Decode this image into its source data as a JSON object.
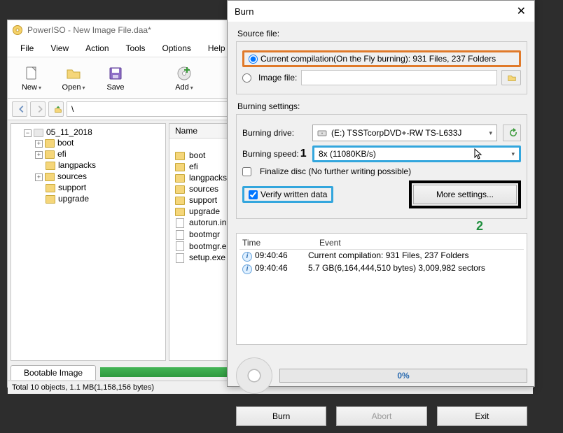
{
  "main": {
    "title": "PowerISO - New Image File.daa*",
    "menu": [
      "File",
      "View",
      "Action",
      "Tools",
      "Options",
      "Help"
    ],
    "toolbar": {
      "new": "New",
      "open": "Open",
      "save": "Save",
      "add": "Add"
    },
    "path": "\\",
    "tree_root": "05_11_2018",
    "tree_children": [
      "boot",
      "efi",
      "langpacks",
      "sources",
      "support",
      "upgrade"
    ],
    "list": {
      "header": "Name",
      "folders": [
        "boot",
        "efi",
        "langpacks",
        "sources",
        "support",
        "upgrade"
      ],
      "files": [
        "autorun.in",
        "bootmgr",
        "bootmgr.e",
        "setup.exe"
      ]
    },
    "tab": "Bootable Image",
    "status": "Total 10 objects, 1.1 MB(1,158,156 bytes)"
  },
  "dialog": {
    "title": "Burn",
    "source_section": "Source file:",
    "radio_current": "Current compilation(On the Fly burning):  931 Files, 237 Folders",
    "radio_image": "Image file:",
    "settings_section": "Burning settings:",
    "drive_label": "Burning drive:",
    "drive_value": "(E:) TSSTcorpDVD+-RW TS-L633J",
    "speed_label": "Burning speed:",
    "speed_value": "8x (11080KB/s)",
    "finalize": "Finalize disc (No further writing possible)",
    "verify": "Verify written data",
    "more": "More settings...",
    "annot1": "1",
    "annot2": "2",
    "log": {
      "h_time": "Time",
      "h_event": "Event",
      "rows": [
        {
          "t": "09:40:46",
          "e": "Current compilation: 931 Files, 237 Folders"
        },
        {
          "t": "09:40:46",
          "e": "5.7 GB(6,164,444,510 bytes)  3,009,982 sectors"
        }
      ]
    },
    "progress": "0%",
    "btn_burn": "Burn",
    "btn_abort": "Abort",
    "btn_exit": "Exit"
  }
}
